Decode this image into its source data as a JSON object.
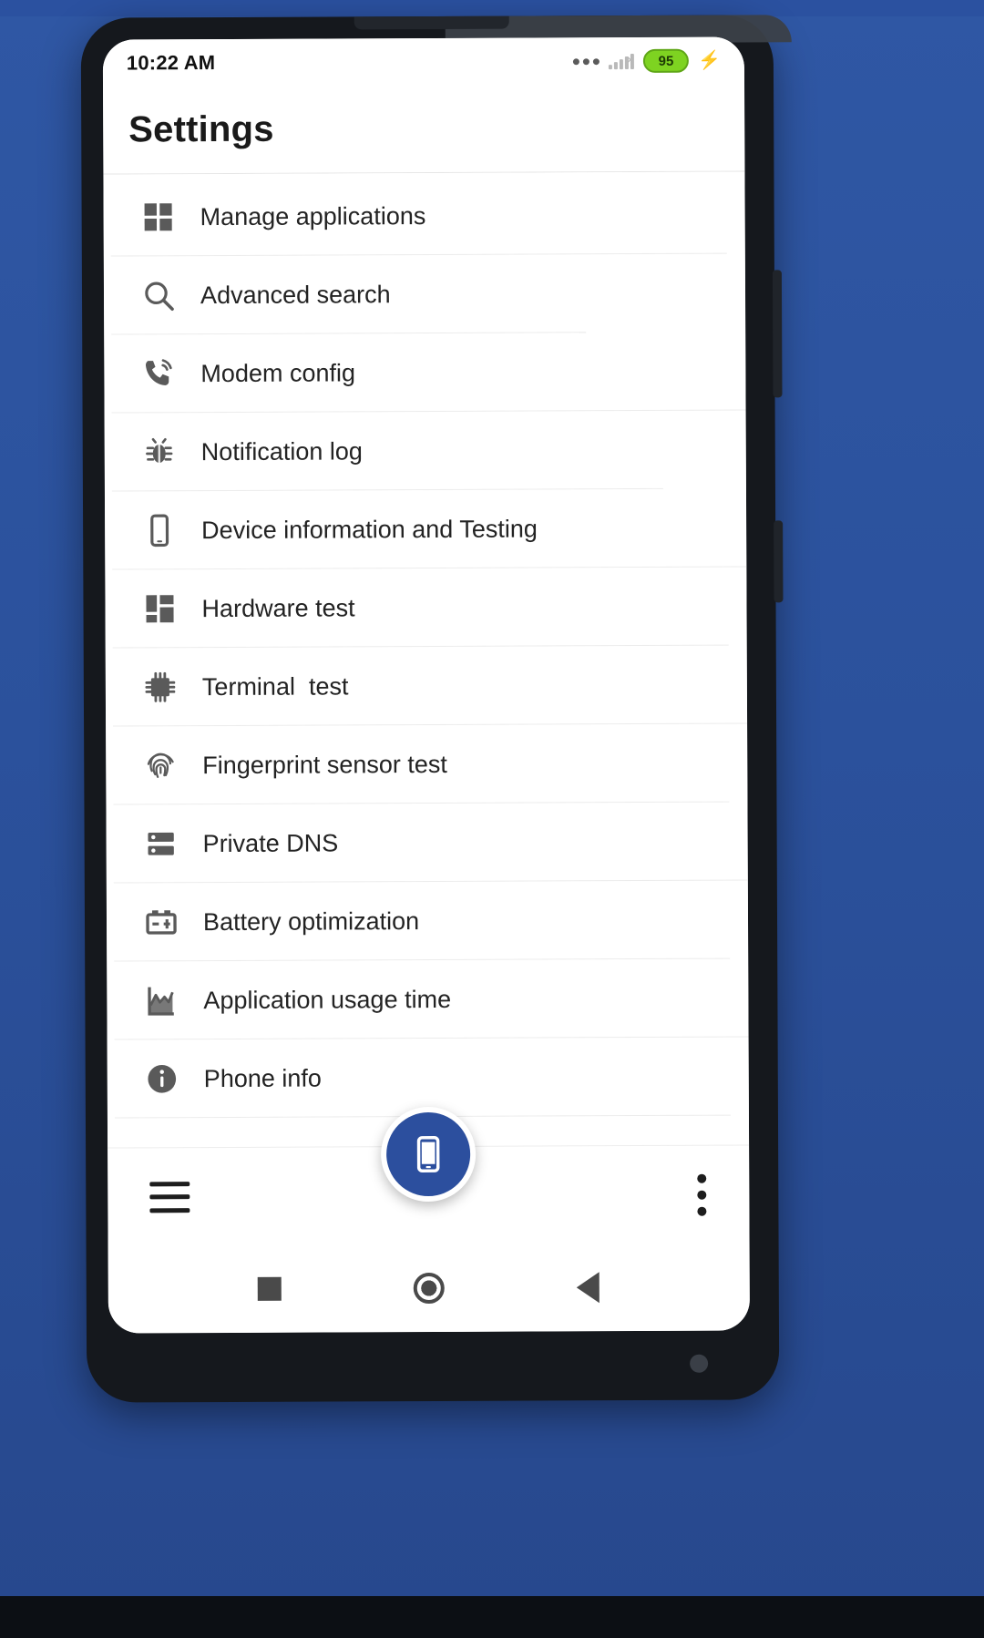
{
  "status_bar": {
    "time": "10:22 AM",
    "more_icon": "more-dots-icon",
    "signal_icon": "signal-bars-no-service-icon",
    "battery_level": "95",
    "charging_icon": "lightning-bolt-icon"
  },
  "app_bar": {
    "title": "Settings"
  },
  "settings_list": [
    {
      "label": "Manage applications",
      "icon": "apps-grid-icon"
    },
    {
      "label": "Advanced search",
      "icon": "search-icon"
    },
    {
      "label": "Modem config",
      "icon": "phone-signal-icon"
    },
    {
      "label": "Notification log",
      "icon": "bug-icon"
    },
    {
      "label": "Device information and Testing",
      "icon": "smartphone-icon"
    },
    {
      "label": "Hardware test",
      "icon": "dashboard-layout-icon"
    },
    {
      "label": "Terminal  test",
      "icon": "cpu-chip-icon"
    },
    {
      "label": "Fingerprint sensor test",
      "icon": "fingerprint-icon"
    },
    {
      "label": "Private DNS",
      "icon": "server-rack-icon"
    },
    {
      "label": "Battery optimization",
      "icon": "car-battery-icon"
    },
    {
      "label": "Application usage time",
      "icon": "line-chart-icon"
    },
    {
      "label": "Phone info",
      "icon": "info-circle-icon"
    }
  ],
  "bottom_bar": {
    "menu_icon": "hamburger-menu-icon",
    "fab_icon": "smartphone-icon",
    "fab_color": "#2c4f9e",
    "overflow_icon": "kebab-menu-icon"
  },
  "navigation_bar": {
    "recents_icon": "square-recents-icon",
    "home_icon": "circle-home-icon",
    "back_icon": "triangle-back-icon"
  },
  "theme": {
    "background": "#2d55a0",
    "accent": "#2c4f9e",
    "battery_green": "#7ed321",
    "text": "#232323"
  }
}
